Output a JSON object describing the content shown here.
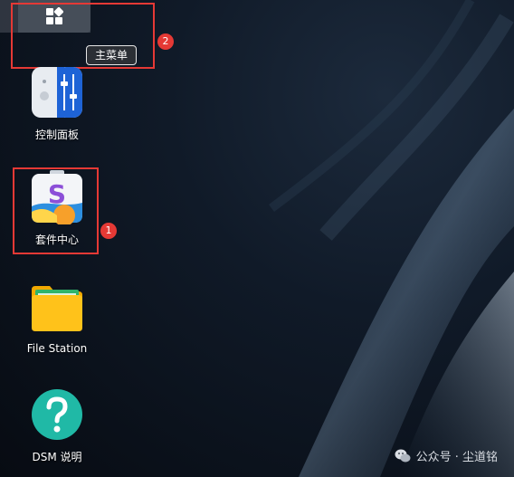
{
  "taskbar": {
    "main_menu_icon": "grid-icon",
    "tooltip": "主菜单"
  },
  "annotations": [
    {
      "number": "1",
      "color": "#e53935"
    },
    {
      "number": "2",
      "color": "#e53935"
    }
  ],
  "desktop": {
    "items": [
      {
        "label": "控制面板",
        "icon": "control-panel-icon"
      },
      {
        "label": "套件中心",
        "icon": "package-center-icon"
      },
      {
        "label": "File Station",
        "icon": "folder-icon"
      },
      {
        "label": "DSM 说明",
        "icon": "help-icon"
      }
    ]
  },
  "watermark": {
    "text": "公众号 · 尘道铭",
    "icon": "wechat-icon"
  }
}
